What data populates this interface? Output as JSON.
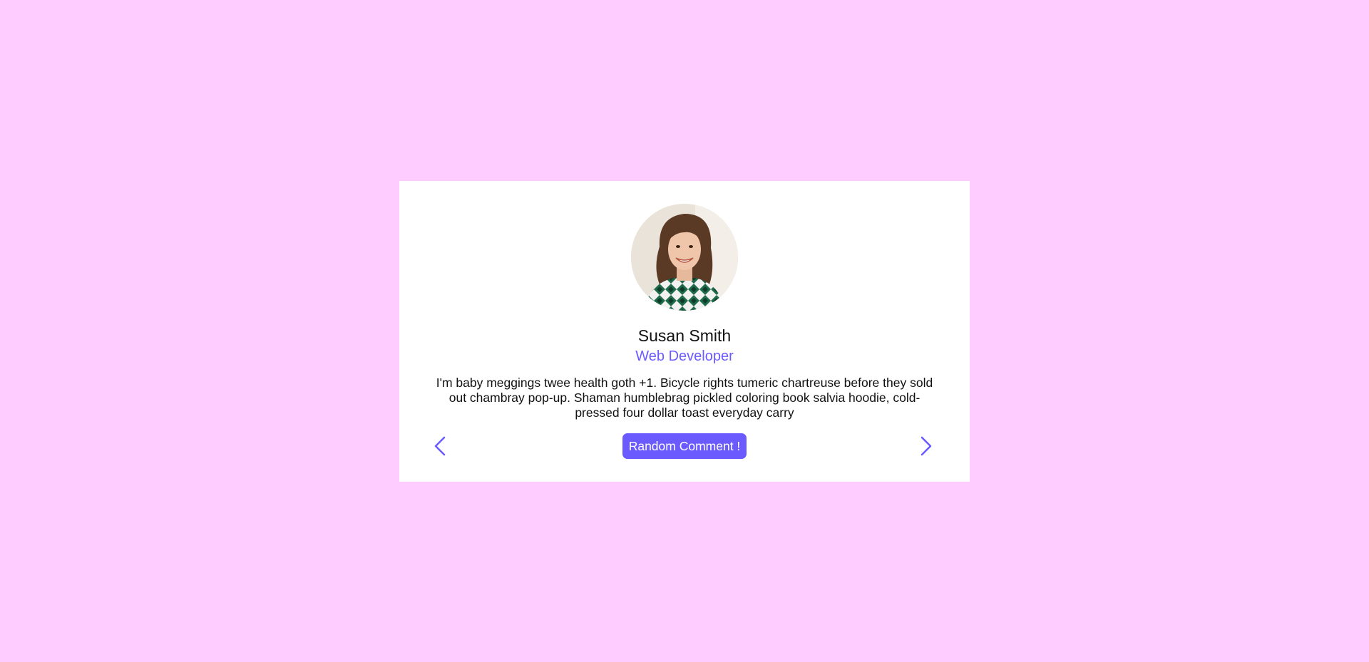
{
  "review": {
    "name": "Susan Smith",
    "job": "Web Developer",
    "text": "I'm baby meggings twee health goth +1. Bicycle rights tumeric chartreuse before they sold out chambray pop-up. Shaman humblebrag pickled coloring book salvia hoodie, cold-pressed four dollar toast everyday carry"
  },
  "controls": {
    "random_label": "Random Comment !",
    "prev_icon": "chevron-left-icon",
    "next_icon": "chevron-right-icon"
  },
  "colors": {
    "page_background": "#ffccff",
    "card_background": "#ffffff",
    "accent": "#6b5bff",
    "text": "#111111"
  }
}
